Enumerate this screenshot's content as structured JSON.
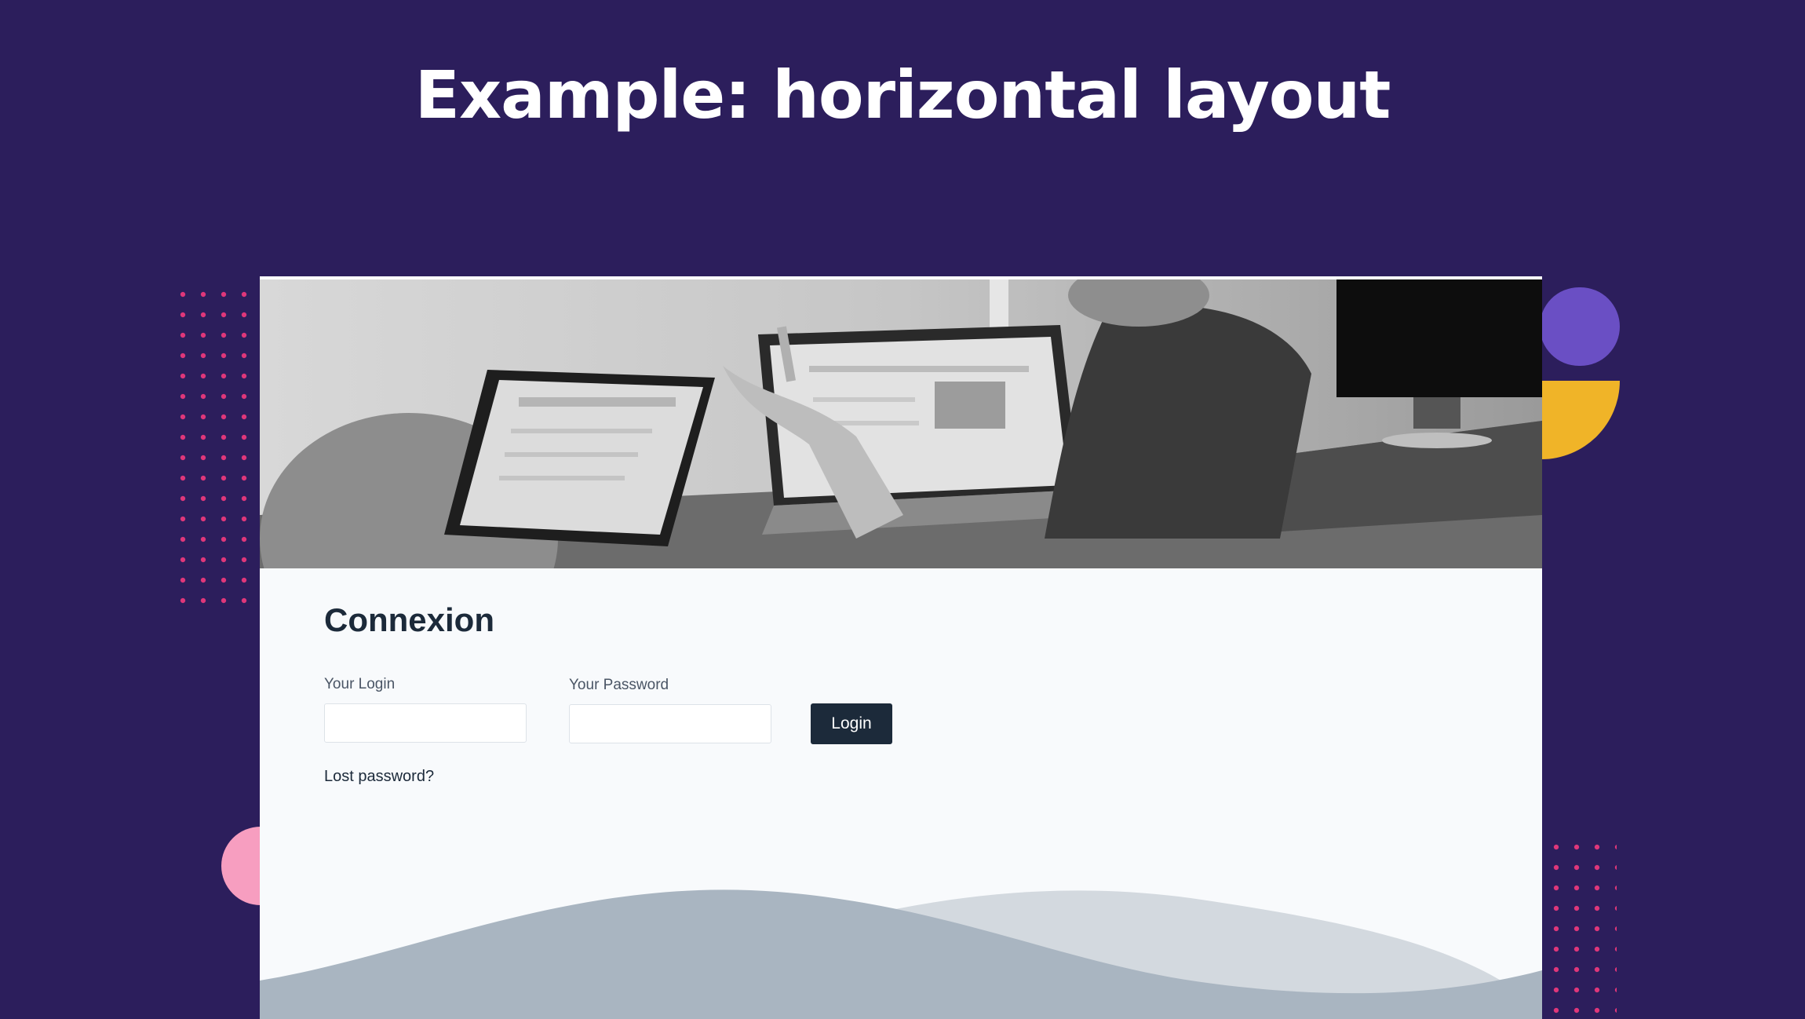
{
  "slide": {
    "title": "Example: horizontal layout"
  },
  "login": {
    "title": "Connexion",
    "login_label": "Your Login",
    "login_value": "",
    "password_label": "Your Password",
    "password_value": "",
    "submit_label": "Login",
    "lost_password_label": "Lost password?"
  },
  "colors": {
    "background": "#2c1e5c",
    "card": "#f8fafc",
    "button": "#1c2a3a",
    "accent_dots": "#e0377a",
    "shape_purple": "#6a4fc4",
    "shape_yellow": "#f0b428",
    "shape_pink": "#f79ec0",
    "wave_dark": "#a9b5c1",
    "wave_light": "#d3d9df"
  },
  "hero_image": {
    "icon": "office-laptops-photo"
  }
}
